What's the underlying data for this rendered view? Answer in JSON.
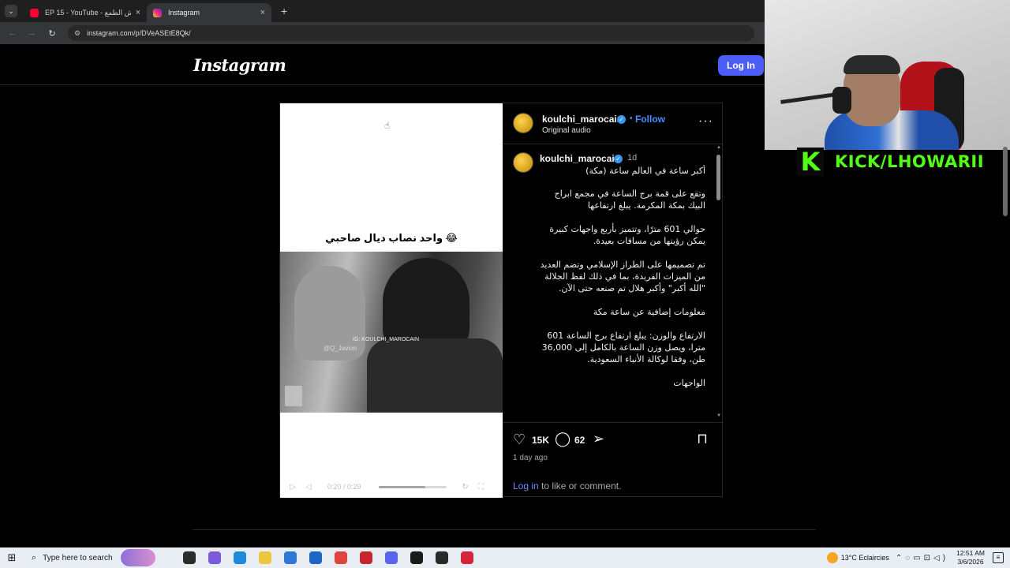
{
  "browser": {
    "tabs": [
      {
        "title": "EP 15 - YouTube - عش الطمع",
        "favicon": "youtube-icon",
        "active": false
      },
      {
        "title": "Instagram",
        "favicon": "instagram-icon",
        "active": true
      }
    ],
    "new_tab_glyph": "+",
    "close_glyph": "×",
    "url": "instagram.com/p/DVeASEtE8Qk/"
  },
  "instagram": {
    "logo": "Instagram",
    "login_button": "Log In",
    "post": {
      "video_caption": "واحد نصاب ديال صاحبي 😂",
      "watermark_line1": "IG: KOULCHI_MAROCAIN",
      "watermark_line2": "@Q_Javion",
      "video_time": "0:20 / 0:29",
      "video_progress_fraction": 0.69,
      "author": "koulchi_marocain",
      "follow_separator": "•",
      "follow_label": "Follow",
      "audio": "Original audio",
      "more_glyph": "···",
      "comment_author": "koulchi_marocain",
      "comment_age": "1d",
      "caption_paragraphs": [
        "أكبر ساعة في العالم ساعة (مكة)",
        "وتقع على قمة برج الساعة في مجمع ابراج البيك بمكة المكرمة. يبلغ ارتفاعها",
        "حوالي 601 مترًا، وتتميز بأربع واجهات كبيرة يمكن رؤيتها من مسافات بعيدة.",
        "تم تصميمها على الطراز الإسلامي وتضم العديد من الميزات الفريدة، بما في ذلك لفظ الجلالة \"الله أكبر\" وأكبر هلال تم صنعه حتى الآن.",
        "معلومات إضافية عن ساعة مكة",
        "الارتفاع والوزن: يبلغ ارتفاع برج الساعة 601 مترا، ويصل وزن الساعة بالكامل إلى 36,000 طن، وفقا لوكالة الأنباء السعودية.",
        "الواجهات"
      ],
      "likes": "15K",
      "comments": "62",
      "posted": "1 day ago",
      "login_link": "Log in",
      "login_rest": " to like or comment."
    }
  },
  "stream": {
    "kick_logo": "K",
    "kick_handle": "KICK/LHOWARII"
  },
  "taskbar": {
    "search_placeholder": "Type here to search",
    "weather": "13°C  Eclaircies",
    "time": "12:51 AM",
    "date": "3/6/2026",
    "apps": [
      {
        "name": "task-view-icon",
        "color": "#2b2b2b"
      },
      {
        "name": "copilot-icon",
        "color": "#7b5cd6"
      },
      {
        "name": "edge-icon",
        "color": "#1f8ad8"
      },
      {
        "name": "file-explorer-icon",
        "color": "#f0c53a"
      },
      {
        "name": "store-icon",
        "color": "#2d78d4"
      },
      {
        "name": "outlook-icon",
        "color": "#1a66c4"
      },
      {
        "name": "chrome-icon",
        "color": "#e0453a"
      },
      {
        "name": "record-app-icon",
        "color": "#c9252e"
      },
      {
        "name": "discord-icon",
        "color": "#5865f2"
      },
      {
        "name": "capcut-icon",
        "color": "#1b1b1b"
      },
      {
        "name": "obs-icon",
        "color": "#2a2a2a"
      },
      {
        "name": "red-app-icon",
        "color": "#d6243a"
      }
    ]
  }
}
